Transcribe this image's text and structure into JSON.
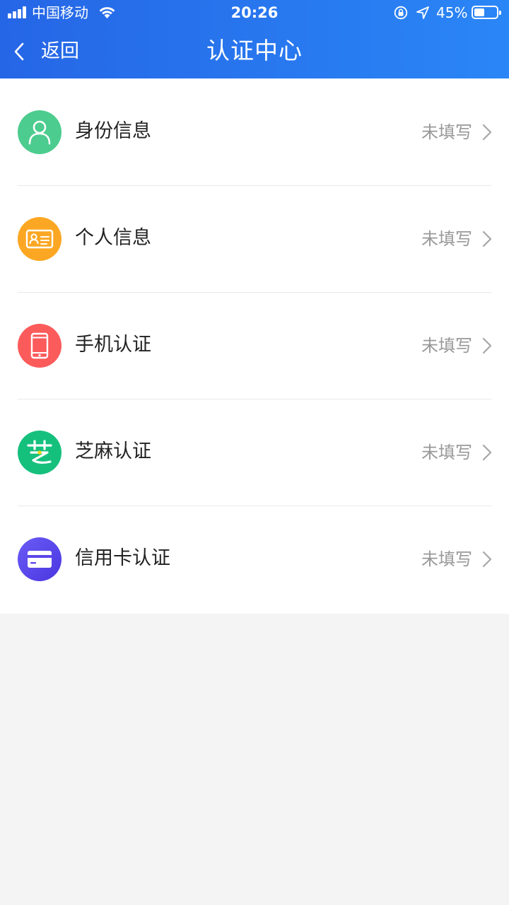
{
  "status_bar": {
    "carrier": "中国移动",
    "time": "20:26",
    "battery_percent": "45%",
    "battery_level": 0.45
  },
  "nav": {
    "back_label": "返回",
    "title": "认证中心"
  },
  "items": [
    {
      "label": "身份信息",
      "status": "未填写",
      "icon": "person-icon",
      "color": "#4ccc8e"
    },
    {
      "label": "个人信息",
      "status": "未填写",
      "icon": "id-card-icon",
      "color": "#fca723"
    },
    {
      "label": "手机认证",
      "status": "未填写",
      "icon": "phone-icon",
      "color": "#fc5b5b"
    },
    {
      "label": "芝麻认证",
      "status": "未填写",
      "icon": "sesame-icon",
      "color": "#15c07d"
    },
    {
      "label": "信用卡认证",
      "status": "未填写",
      "icon": "credit-card-icon",
      "color": "#5b47ea"
    }
  ],
  "colors": {
    "header_start": "#2566e6",
    "header_end": "#2a86f6",
    "page_bg": "#f4f4f4",
    "status_text": "#999999"
  }
}
